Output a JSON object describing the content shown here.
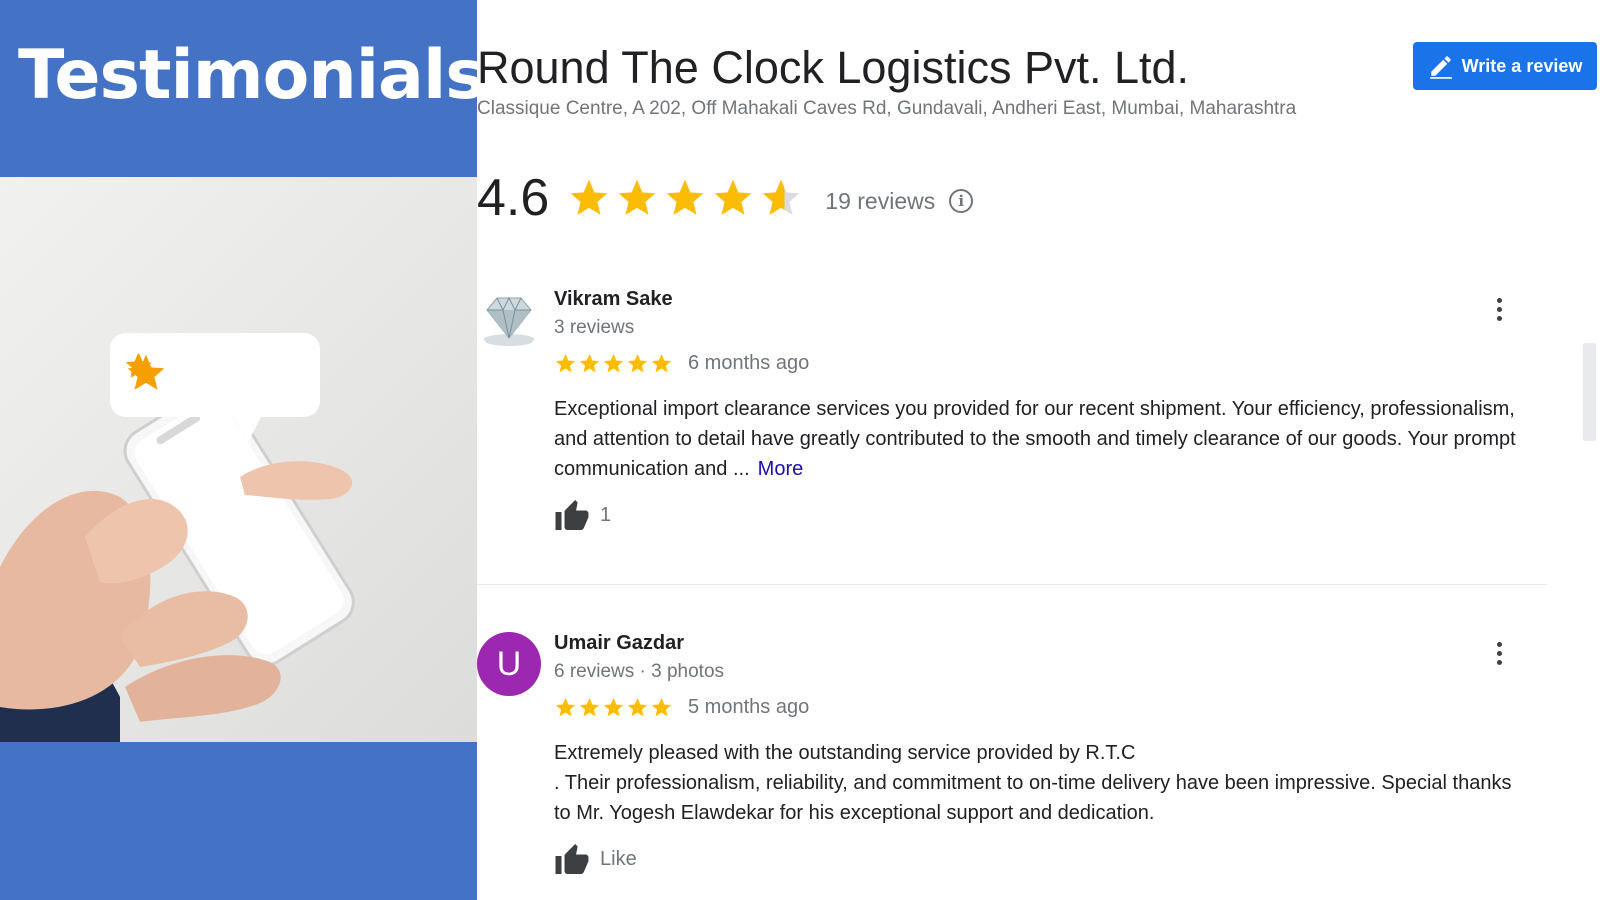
{
  "left": {
    "title": "Testimonials"
  },
  "business": {
    "name": "Round The Clock Logistics Pvt. Ltd.",
    "address": "Classique Centre, A 202, Off Mahakali Caves Rd, Gundavali, Andheri East, Mumbai, Maharashtra",
    "write_review_label": "Write a review",
    "rating": "4.6",
    "rating_value": 4.6,
    "review_count": "19 reviews"
  },
  "reviews": [
    {
      "name": "Vikram Sake",
      "meta": "3 reviews",
      "stars": 5,
      "date": "6 months ago",
      "text": "Exceptional import clearance services you provided for our recent shipment. Your efficiency, professionalism, and attention to detail have greatly contributed to the smooth and timely clearance of our goods. Your prompt communication and ...",
      "more_label": "More",
      "like_label": "1"
    },
    {
      "name": "Umair Gazdar",
      "avatar_letter": "U",
      "meta": "6 reviews · 3 photos",
      "stars": 5,
      "date": "5 months ago",
      "text": "Extremely pleased with the outstanding service provided by R.T.C\n. Their professionalism, reliability, and commitment to on-time delivery have been  impressive. Special thanks to Mr. Yogesh Elawdekar for his exceptional support and dedication.",
      "like_label": "Like"
    }
  ],
  "colors": {
    "panel_blue": "#4472c4",
    "button_blue": "#1a73e8",
    "star_gold": "#fbbc04",
    "link": "#1a0dab",
    "avatar_purple": "#9c27b0"
  },
  "icons": {
    "rating_info": "info-icon",
    "write_review": "pencil-icon",
    "like": "thumbs-up-icon",
    "menu": "more-vert-icon"
  }
}
